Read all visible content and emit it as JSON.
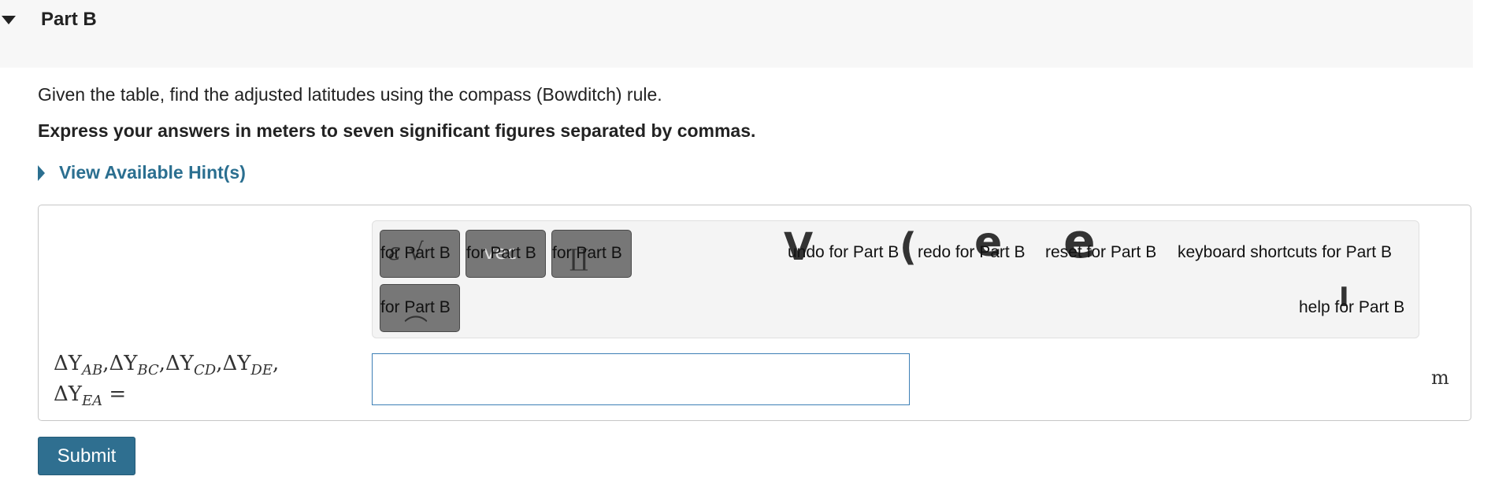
{
  "part": {
    "title": "Part B",
    "collapse_icon": "caret-down-icon"
  },
  "problem": {
    "instruction": "Given the table, find the adjusted latitudes using the compass (Bowditch) rule.",
    "answer_format": "Express your answers in meters to seven significant figures separated by commas."
  },
  "hints": {
    "label": "View Available Hint(s)",
    "icon": "caret-right-icon"
  },
  "toolbar": {
    "buttons": [
      {
        "label": "for Part B",
        "glyph": "ε √",
        "icon": "templates-icon"
      },
      {
        "label": "for Part B",
        "glyph": "vec",
        "icon": "vector-icon"
      },
      {
        "label": "for Part B",
        "glyph": "∐",
        "icon": "symbols-icon"
      },
      {
        "label": "for Part B",
        "glyph": "⌒",
        "icon": "more-icon"
      }
    ],
    "undo": "undo for Part B",
    "redo": "redo for Part B",
    "reset": "reset for Part B",
    "keyboard": "keyboard shortcuts for Part B",
    "help": "help for Part B"
  },
  "answer": {
    "label_line1": "ΔY",
    "subs": [
      "AB",
      "BC",
      "CD",
      "DE",
      "EA"
    ],
    "value": "",
    "unit": "m"
  },
  "submit_label": "Submit"
}
